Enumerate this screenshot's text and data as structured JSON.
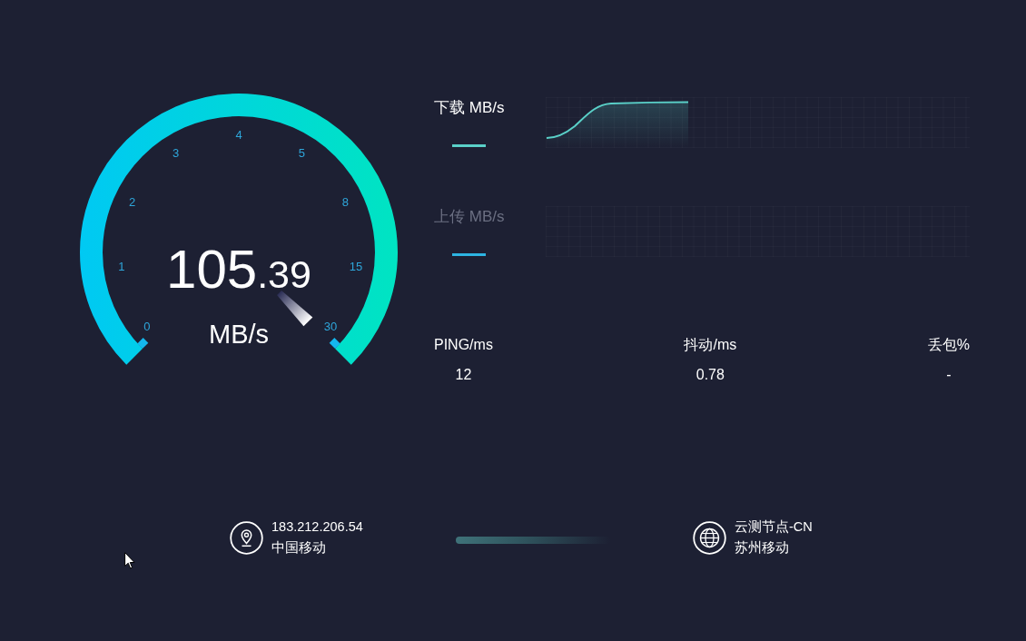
{
  "gauge": {
    "ticks": [
      "0",
      "1",
      "2",
      "3",
      "4",
      "5",
      "8",
      "15",
      "30"
    ],
    "reading_whole": "105",
    "reading_fraction": ".39",
    "unit": "MB/s",
    "level": 1
  },
  "graphs": [
    {
      "label": "下载 MB/s",
      "active": true,
      "color": "#5ad0c8"
    },
    {
      "label": "上传 MB/s",
      "active": false,
      "color": "#2db4e2"
    }
  ],
  "stats": [
    {
      "label": "PING/ms",
      "value": "12"
    },
    {
      "label": "抖动/ms",
      "value": "0.78"
    },
    {
      "label": "丢包%",
      "value": "-"
    }
  ],
  "client": {
    "ip": "183.212.206.54",
    "isp": "中国移动"
  },
  "server": {
    "name": "云测节点-CN",
    "isp": "苏州移动"
  }
}
